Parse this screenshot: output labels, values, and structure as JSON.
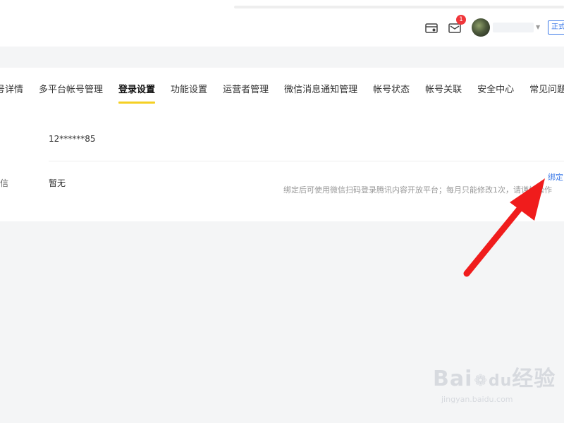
{
  "header": {
    "message_badge": "1",
    "status_tag": "正式",
    "icons": [
      "card-icon",
      "mail-icon"
    ]
  },
  "tabs": [
    {
      "label": "号详情"
    },
    {
      "label": "多平台帐号管理"
    },
    {
      "label": "登录设置",
      "active": true
    },
    {
      "label": "功能设置"
    },
    {
      "label": "运营者管理"
    },
    {
      "label": "微信消息通知管理"
    },
    {
      "label": "帐号状态"
    },
    {
      "label": "帐号关联"
    },
    {
      "label": "安全中心"
    },
    {
      "label": "常见问题"
    }
  ],
  "settings": {
    "phone_value": "12******85",
    "wechat_label": "微信",
    "wechat_value": "暂无",
    "hint": "绑定后可使用微信扫码登录腾讯内容开放平台；每月只能修改1次，请谨慎操作",
    "bind_label": "绑定"
  },
  "watermark": {
    "brand_left": "Bai",
    "brand_right": "经验",
    "sub": "jingyan.baidu.com"
  },
  "colors": {
    "accent_yellow": "#f5d023",
    "link_blue": "#3c7ae8",
    "badge_red": "#f0363a",
    "arrow_red": "#f01c1c"
  }
}
